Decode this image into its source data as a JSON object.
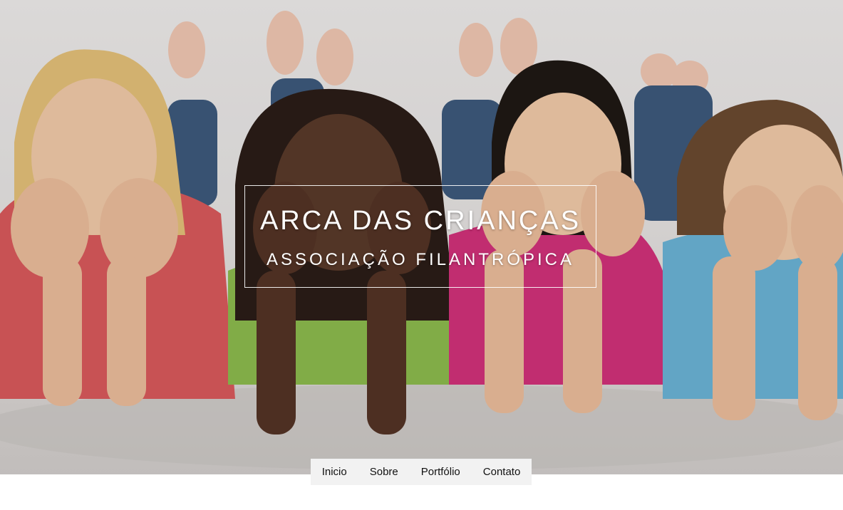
{
  "hero": {
    "image": "four smiling children lying on the floor, chins resting on hands",
    "title": "ARCA DAS CRIANÇAS",
    "subtitle": "ASSOCIAÇÃO FILANTRÓPICA"
  },
  "nav": {
    "items": [
      {
        "label": "Inicio"
      },
      {
        "label": "Sobre"
      },
      {
        "label": "Portfólio"
      },
      {
        "label": "Contato"
      }
    ]
  },
  "colors": {
    "shirt_red": "#d95a5c",
    "shirt_green": "#8dbb4e",
    "shirt_pink": "#d2317a",
    "shirt_blue": "#6bb3d6",
    "nav_bg": "#f2f2f2"
  }
}
